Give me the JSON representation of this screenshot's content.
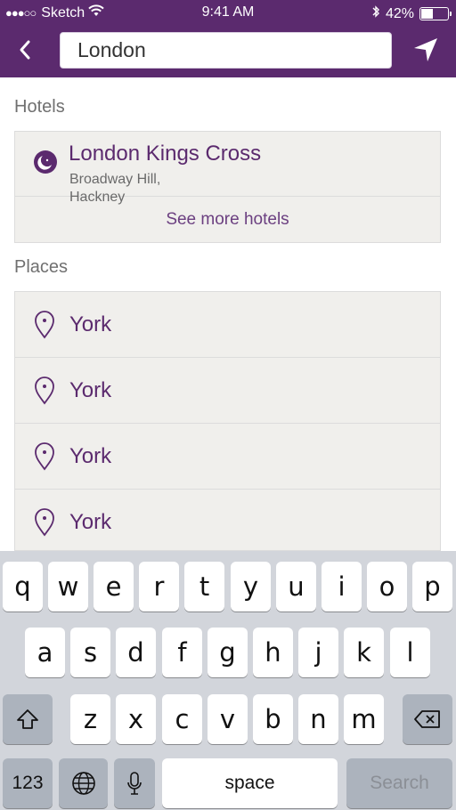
{
  "status_bar": {
    "signal": "●●●○○",
    "carrier": "Sketch",
    "time": "9:41 AM",
    "battery_percent": "42%",
    "battery_level": 0.42
  },
  "header": {
    "search_value": "London",
    "back_icon": "chevron-left-icon",
    "locate_icon": "location-arrow-icon",
    "brand_color": "#5b2a6e"
  },
  "hotels": {
    "title": "Hotels",
    "items": [
      {
        "name": "London Kings Cross",
        "address_line1": "Broadway Hill,",
        "address_line2": "Hackney"
      }
    ],
    "see_more": "See more hotels"
  },
  "places": {
    "title": "Places",
    "items": [
      {
        "name": "York"
      },
      {
        "name": "York"
      },
      {
        "name": "York"
      },
      {
        "name": "York"
      }
    ]
  },
  "keyboard": {
    "row1": [
      "q",
      "w",
      "e",
      "r",
      "t",
      "y",
      "u",
      "i",
      "o",
      "p"
    ],
    "row2": [
      "a",
      "s",
      "d",
      "f",
      "g",
      "h",
      "j",
      "k",
      "l"
    ],
    "row3": [
      "z",
      "x",
      "c",
      "v",
      "b",
      "n",
      "m"
    ],
    "numbers_label": "123",
    "space_label": "space",
    "search_label": "Search"
  }
}
